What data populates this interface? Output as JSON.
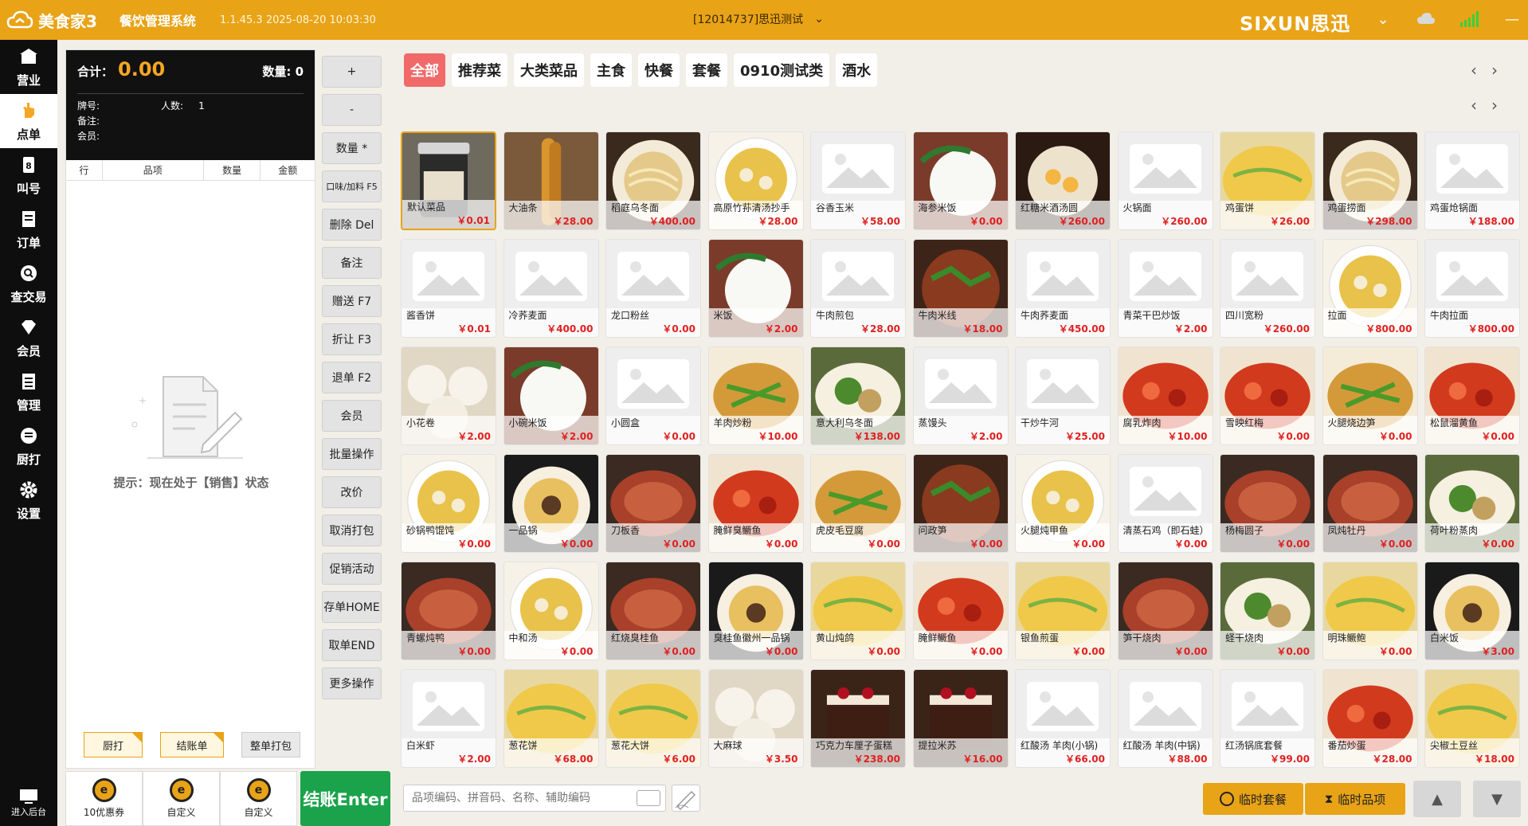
{
  "titlebar": {
    "app_name": "美食家3",
    "system_name": "餐饮管理系统",
    "version": "1.1.45.3 2025-08-20 10:03:30",
    "store": "[12014737]思迅测试",
    "brand": "SIXUN思迅"
  },
  "colors": {
    "accent": "#e8a317",
    "price": "#e02020",
    "active_cat": "#f06a6a",
    "checkout": "#1aa34a"
  },
  "nav": [
    {
      "label": "营业",
      "icon": "shop-icon"
    },
    {
      "label": "点单",
      "icon": "hand-icon"
    },
    {
      "label": "叫号",
      "icon": "number-icon"
    },
    {
      "label": "订单",
      "icon": "document-icon"
    },
    {
      "label": "查交易",
      "icon": "search-icon"
    },
    {
      "label": "会员",
      "icon": "diamond-icon"
    },
    {
      "label": "管理",
      "icon": "list-icon"
    },
    {
      "label": "厨打",
      "icon": "menu-icon"
    },
    {
      "label": "设置",
      "icon": "gear-icon"
    }
  ],
  "nav_bottom": "进入后台",
  "order": {
    "total_label": "合计：",
    "total_value": "0.00",
    "qty_label": "数量:",
    "qty_value": "0",
    "table_label": "牌号:",
    "people_label": "人数:",
    "people_value": "1",
    "note_label": "备注:",
    "member_label": "会员:",
    "columns": [
      "行",
      "品项",
      "数量",
      "金额"
    ],
    "hint": "提示：现在处于【销售】状态",
    "btn_kitchen": "厨打",
    "btn_bill": "结账单",
    "btn_pack": "整单打包"
  },
  "bottom_actions": [
    "10优惠券",
    "自定义",
    "自定义"
  ],
  "checkout": "结账Enter",
  "actions": [
    "+",
    "-",
    "数量 *",
    "口味/加料 F5",
    "删除 Del",
    "备注",
    "赠送 F7",
    "折让 F3",
    "退单 F2",
    "会员",
    "批量操作",
    "改价",
    "取消打包",
    "促销活动",
    "存单HOME",
    "取单END",
    "更多操作"
  ],
  "categories": [
    "全部",
    "推荐菜",
    "大类菜品",
    "主食",
    "快餐",
    "套餐",
    "0910测试类",
    "酒水"
  ],
  "dishes": [
    {
      "name": "默认菜品",
      "price": "￥0.01",
      "img": "jar"
    },
    {
      "name": "大油条",
      "price": "￥28.00",
      "img": "fritter"
    },
    {
      "name": "稻庭乌冬面",
      "price": "￥400.00",
      "img": "noodle"
    },
    {
      "name": "高原竹荪清汤抄手",
      "price": "￥28.00",
      "img": "soup"
    },
    {
      "name": "谷香玉米",
      "price": "￥58.00",
      "img": ""
    },
    {
      "name": "海参米饭",
      "price": "￥0.00",
      "img": "rice"
    },
    {
      "name": "红糖米酒汤圆",
      "price": "￥260.00",
      "img": "dessert"
    },
    {
      "name": "火锅面",
      "price": "￥260.00",
      "img": ""
    },
    {
      "name": "鸡蛋饼",
      "price": "￥26.00",
      "img": "egg"
    },
    {
      "name": "鸡蛋捞面",
      "price": "￥298.00",
      "img": "noodle"
    },
    {
      "name": "鸡蛋炝锅面",
      "price": "￥188.00",
      "img": ""
    },
    {
      "name": "酱香饼",
      "price": "￥0.01",
      "img": ""
    },
    {
      "name": "冷荞麦面",
      "price": "￥400.00",
      "img": ""
    },
    {
      "name": "龙口粉丝",
      "price": "￥0.00",
      "img": ""
    },
    {
      "name": "米饭",
      "price": "￥2.00",
      "img": "rice"
    },
    {
      "name": "牛肉煎包",
      "price": "￥28.00",
      "img": ""
    },
    {
      "name": "牛肉米线",
      "price": "￥18.00",
      "img": "beef"
    },
    {
      "name": "牛肉荞麦面",
      "price": "￥450.00",
      "img": ""
    },
    {
      "name": "青菜干巴炒饭",
      "price": "￥2.00",
      "img": ""
    },
    {
      "name": "四川宽粉",
      "price": "￥260.00",
      "img": ""
    },
    {
      "name": "拉面",
      "price": "￥800.00",
      "img": "soup"
    },
    {
      "name": "牛肉拉面",
      "price": "￥800.00",
      "img": ""
    },
    {
      "name": "小花卷",
      "price": "￥2.00",
      "img": "bun"
    },
    {
      "name": "小碗米饭",
      "price": "￥2.00",
      "img": "rice"
    },
    {
      "name": "小圆盒",
      "price": "￥0.00",
      "img": ""
    },
    {
      "name": "羊肉炒粉",
      "price": "￥10.00",
      "img": "stirfry"
    },
    {
      "name": "意大利乌冬面",
      "price": "￥138.00",
      "img": "green"
    },
    {
      "name": "蒸馒头",
      "price": "￥2.00",
      "img": ""
    },
    {
      "name": "干炒牛河",
      "price": "￥25.00",
      "img": ""
    },
    {
      "name": "腐乳炸肉",
      "price": "￥10.00",
      "img": "red"
    },
    {
      "name": "雪映红梅",
      "price": "￥0.00",
      "img": "red"
    },
    {
      "name": "火腿烧边笋",
      "price": "￥0.00",
      "img": "stirfry"
    },
    {
      "name": "松鼠溜黄鱼",
      "price": "￥0.00",
      "img": "red"
    },
    {
      "name": "砂锅鸭馄饨",
      "price": "￥0.00",
      "img": "soup"
    },
    {
      "name": "一品锅",
      "price": "￥0.00",
      "img": "pot"
    },
    {
      "name": "刀板香",
      "price": "￥0.00",
      "img": "meat"
    },
    {
      "name": "腌鲜臭鳜鱼",
      "price": "￥0.00",
      "img": "red"
    },
    {
      "name": "虎皮毛豆腐",
      "price": "￥0.00",
      "img": "stirfry"
    },
    {
      "name": "问政笋",
      "price": "￥0.00",
      "img": "beef"
    },
    {
      "name": "火腿炖甲鱼",
      "price": "￥0.00",
      "img": "soup"
    },
    {
      "name": "清蒸石鸡（即石蛙）",
      "price": "￥0.00",
      "img": ""
    },
    {
      "name": "杨梅圆子",
      "price": "￥0.00",
      "img": "meat"
    },
    {
      "name": "凤炖牡丹",
      "price": "￥0.00",
      "img": "meat"
    },
    {
      "name": "荷叶粉蒸肉",
      "price": "￥0.00",
      "img": "green"
    },
    {
      "name": "青螺炖鸭",
      "price": "￥0.00",
      "img": "meat"
    },
    {
      "name": "中和汤",
      "price": "￥0.00",
      "img": "soup"
    },
    {
      "name": "红烧臭桂鱼",
      "price": "￥0.00",
      "img": "meat"
    },
    {
      "name": "臭桂鱼徽州一品锅",
      "price": "￥0.00",
      "img": "pot"
    },
    {
      "name": "黄山炖鸽",
      "price": "￥0.00",
      "img": "egg"
    },
    {
      "name": "腌鲜鳜鱼",
      "price": "￥0.00",
      "img": "red"
    },
    {
      "name": "银鱼煎蛋",
      "price": "￥0.00",
      "img": "egg"
    },
    {
      "name": "笋干烧肉",
      "price": "￥0.00",
      "img": "meat"
    },
    {
      "name": "蛏干烧肉",
      "price": "￥0.00",
      "img": "green"
    },
    {
      "name": "明珠鳜鲍",
      "price": "￥0.00",
      "img": "egg"
    },
    {
      "name": "白米饭",
      "price": "￥3.00",
      "img": "pot"
    },
    {
      "name": "白米虾",
      "price": "￥2.00",
      "img": ""
    },
    {
      "name": "葱花饼",
      "price": "￥68.00",
      "img": "egg"
    },
    {
      "name": "葱花大饼",
      "price": "￥6.00",
      "img": "egg"
    },
    {
      "name": "大麻球",
      "price": "￥3.50",
      "img": "bun"
    },
    {
      "name": "巧克力车厘子蛋糕",
      "price": "￥238.00",
      "img": "cake"
    },
    {
      "name": "提拉米苏",
      "price": "￥16.00",
      "img": "cake"
    },
    {
      "name": "红酸汤 羊肉(小锅)",
      "price": "￥66.00",
      "img": ""
    },
    {
      "name": "红酸汤 羊肉(中锅)",
      "price": "￥88.00",
      "img": ""
    },
    {
      "name": "红汤锅底套餐",
      "price": "￥99.00",
      "img": ""
    },
    {
      "name": "番茄炒蛋",
      "price": "￥28.00",
      "img": "red"
    },
    {
      "name": "尖椒土豆丝",
      "price": "￥18.00",
      "img": "egg"
    }
  ],
  "search": {
    "placeholder": "品项编码、拼音码、名称、辅助编码"
  },
  "temp_set": "临时套餐",
  "temp_item": "临时品项"
}
